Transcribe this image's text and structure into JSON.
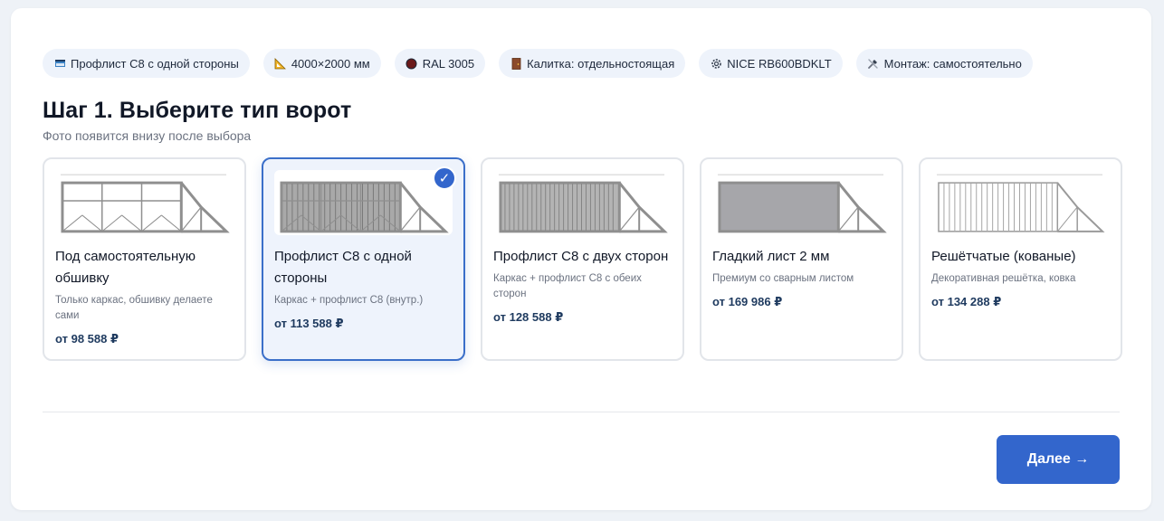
{
  "summary_chips": [
    {
      "icon": "sheet-icon",
      "label": "Профлист С8 с одной стороны"
    },
    {
      "icon": "ruler-icon",
      "label": "4000×2000 мм"
    },
    {
      "icon": "color-dot-icon",
      "label": "RAL 3005"
    },
    {
      "icon": "door-icon",
      "label": "Калитка: отдельностоящая"
    },
    {
      "icon": "gear-icon",
      "label": "NICE RB600BDKLT"
    },
    {
      "icon": "tools-icon",
      "label": "Монтаж: самостоятельно"
    }
  ],
  "step": {
    "title": "Шаг 1. Выберите тип ворот",
    "subtitle": "Фото появится внизу после выбора"
  },
  "gate_types": [
    {
      "id": "frame",
      "title": "Под самостоятельную обшивку",
      "description": "Только каркас, обшивку делаете сами",
      "price": "от 98 588 ₽",
      "selected": false
    },
    {
      "id": "c8-one",
      "title": "Профлист С8 с одной стороны",
      "description": "Каркас + профлист С8 (внутр.)",
      "price": "от 113 588 ₽",
      "selected": true
    },
    {
      "id": "c8-two",
      "title": "Профлист С8 с двух сторон",
      "description": "Каркас + профлист С8 с обеих сторон",
      "price": "от 128 588 ₽",
      "selected": false
    },
    {
      "id": "smooth",
      "title": "Гладкий лист 2 мм",
      "description": "Премиум со сварным листом",
      "price": "от 169 986 ₽",
      "selected": false
    },
    {
      "id": "lattice",
      "title": "Решётчатые (кованые)",
      "description": "Декоративная решётка, ковка",
      "price": "от 134 288 ₽",
      "selected": false
    }
  ],
  "colors": {
    "accent": "#3366cc",
    "selected_card_bg": "#eef3fc",
    "color_dot": "#6b1a1a",
    "gate_frame": "#8f8f8f"
  },
  "actions": {
    "next_label": "Далее →"
  }
}
